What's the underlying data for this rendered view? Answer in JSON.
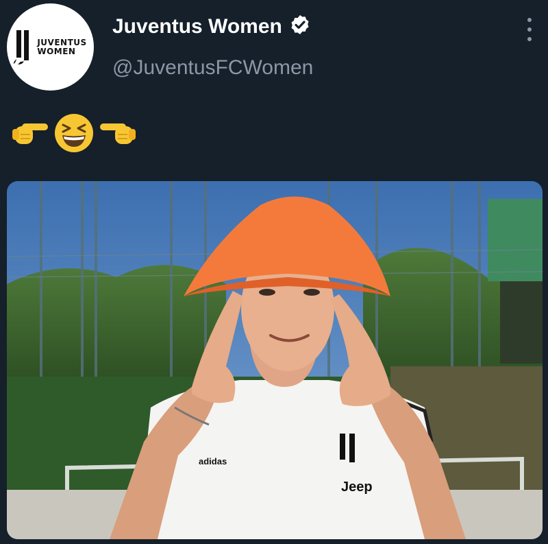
{
  "tweet": {
    "author": {
      "display_name": "Juventus Women",
      "handle": "@JuventusFCWomen",
      "verified": true,
      "avatar": {
        "icon": "juventus-logo",
        "text_line1": "JUVENTUS",
        "text_line2": "WOMEN",
        "background": "#ffffff"
      }
    },
    "menu_icon": "more-vertical-icon",
    "emojis": [
      "backhand-index-pointing-right",
      "grinning-squinting-face",
      "backhand-index-pointing-left"
    ],
    "media": {
      "type": "photo",
      "subject": "player-with-orange-cone-hat",
      "shirt_text": "Jeep",
      "shirt_brand": "adidas"
    }
  },
  "colors": {
    "background": "#15202b",
    "text_primary": "#ffffff",
    "text_secondary": "#8b98a5",
    "hat_orange": "#f47a3c",
    "emoji_yellow": "#f7c733"
  }
}
